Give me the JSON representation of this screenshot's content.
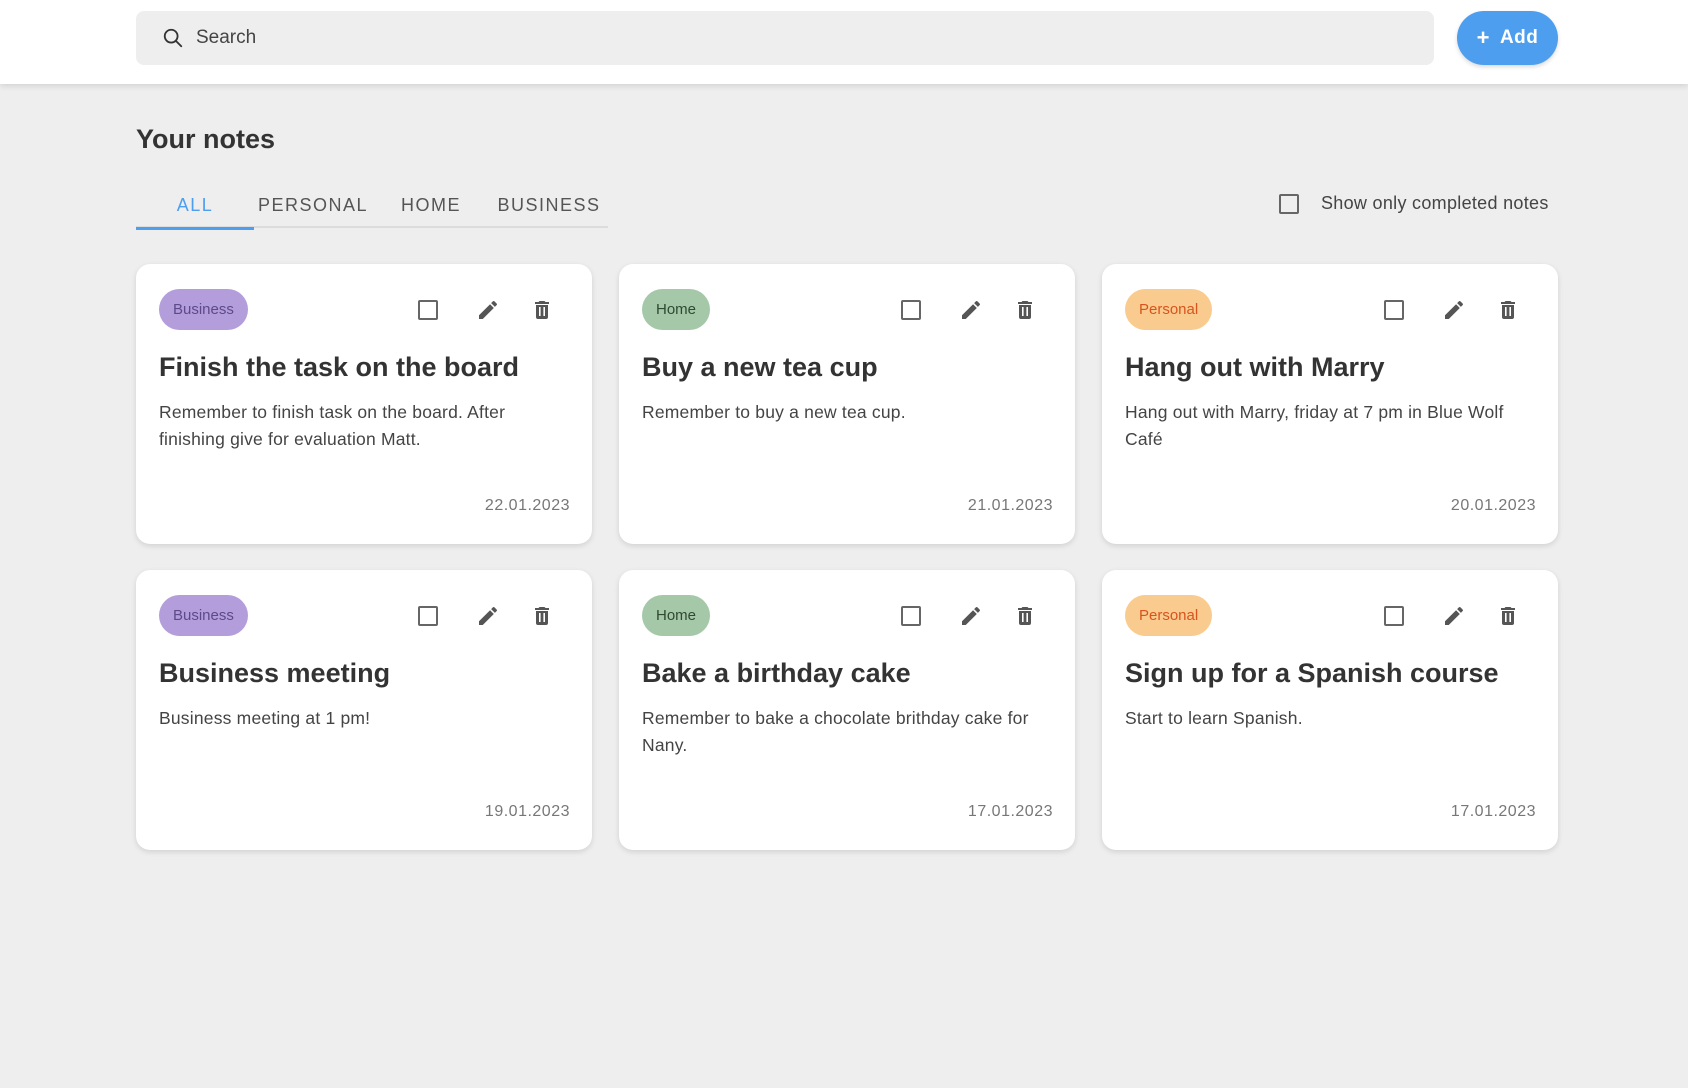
{
  "header": {
    "search_placeholder": "Search",
    "search_value": "",
    "add_label": "Add",
    "add_icon": "plus-icon"
  },
  "page": {
    "title": "Your notes"
  },
  "tabs": [
    {
      "label": "ALL",
      "active": true
    },
    {
      "label": "PERSONAL",
      "active": false
    },
    {
      "label": "HOME",
      "active": false
    },
    {
      "label": "BUSINESS",
      "active": false
    }
  ],
  "filter": {
    "completed_label": "Show only completed notes",
    "completed_checked": false
  },
  "colors": {
    "accent": "#4e9ef0",
    "business_badge": "#b39ddb",
    "home_badge": "#a5c8a8",
    "personal_badge": "#f9cb8f"
  },
  "notes": [
    {
      "category": "Business",
      "title": "Finish the task on the board",
      "description": "Remember to finish task on the board. After finishing give for evaluation Matt.",
      "date": "22.01.2023",
      "completed": false
    },
    {
      "category": "Home",
      "title": "Buy a new tea cup",
      "description": "Remember to buy a new tea cup.",
      "date": "21.01.2023",
      "completed": false
    },
    {
      "category": "Personal",
      "title": "Hang out with Marry",
      "description": "Hang out with Marry, friday at 7 pm in Blue Wolf Café",
      "date": "20.01.2023",
      "completed": false
    },
    {
      "category": "Business",
      "title": "Business meeting",
      "description": "Business meeting at 1 pm!",
      "date": "19.01.2023",
      "completed": false
    },
    {
      "category": "Home",
      "title": "Bake a birthday cake",
      "description": "Remember to bake a chocolate brithday cake for Nany.",
      "date": "17.01.2023",
      "completed": false
    },
    {
      "category": "Personal",
      "title": "Sign up for a Spanish course",
      "description": "Start to learn Spanish.",
      "date": "17.01.2023",
      "completed": false
    }
  ]
}
